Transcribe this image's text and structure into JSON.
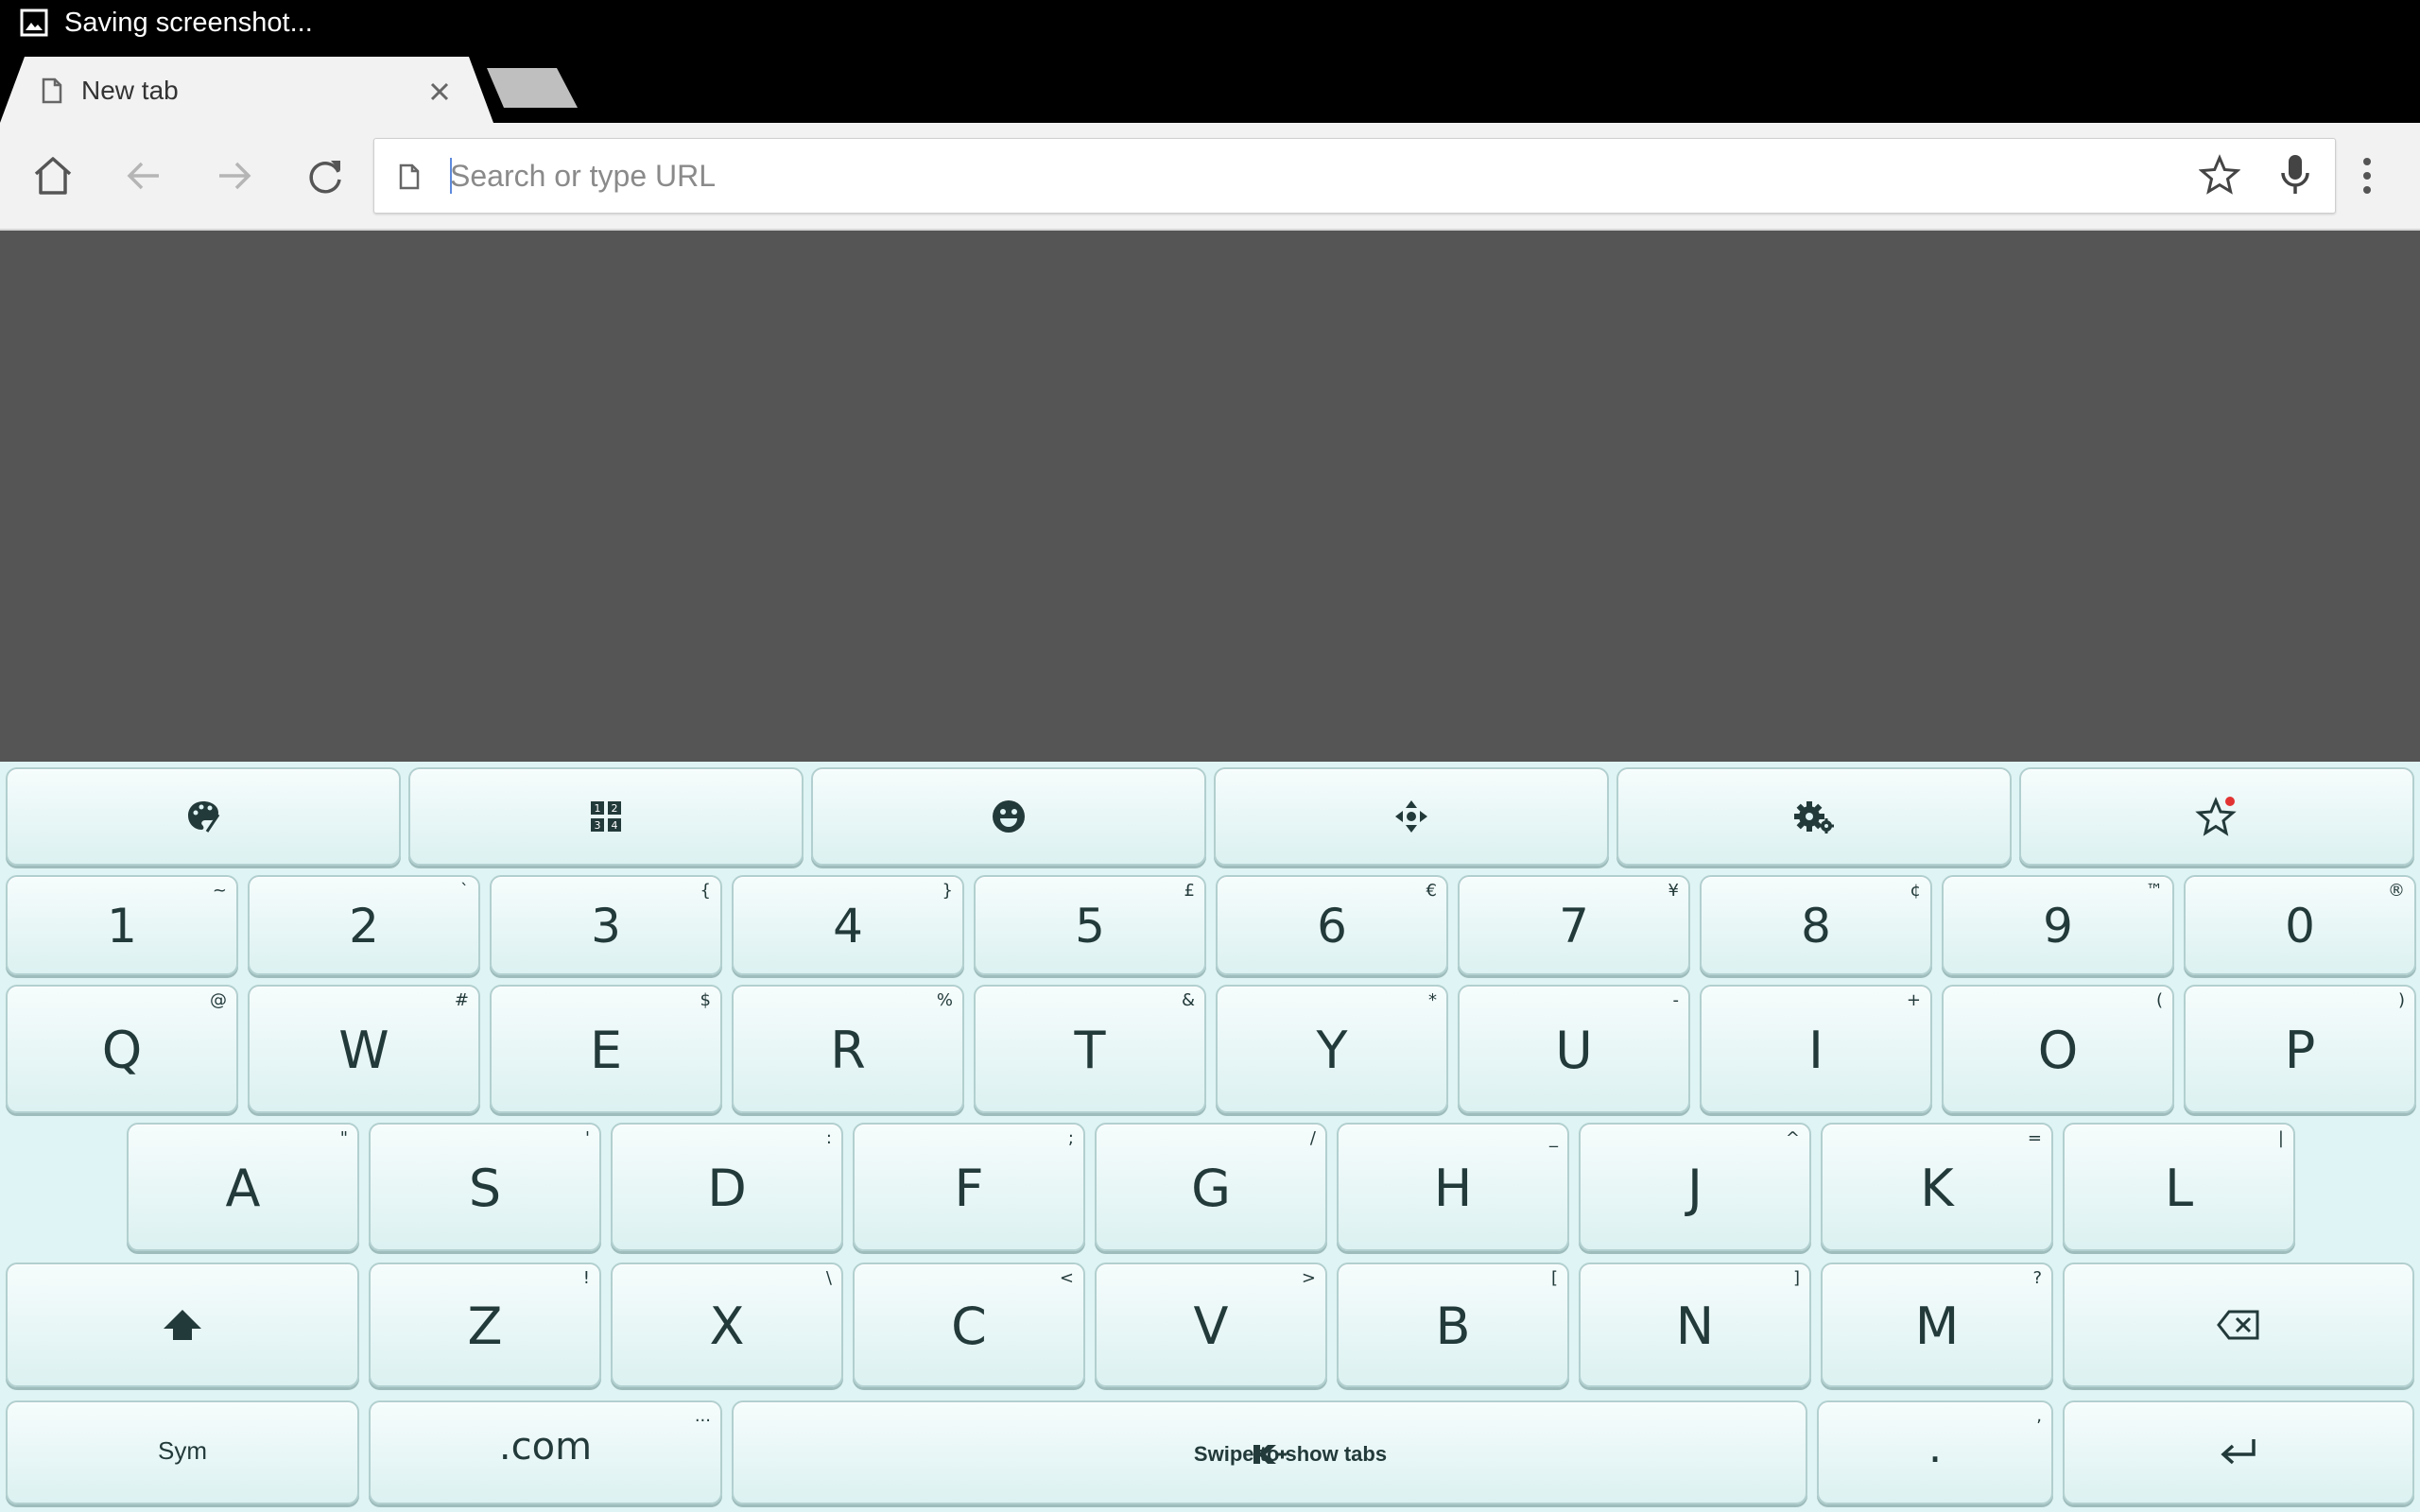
{
  "status_bar": {
    "notification_text": "Saving screenshot..."
  },
  "tab": {
    "title": "New tab"
  },
  "omnibox": {
    "placeholder": "Search or type URL"
  },
  "keyboard": {
    "number_row": [
      {
        "label": "1",
        "hint": "~"
      },
      {
        "label": "2",
        "hint": "`"
      },
      {
        "label": "3",
        "hint": "{"
      },
      {
        "label": "4",
        "hint": "}"
      },
      {
        "label": "5",
        "hint": "£"
      },
      {
        "label": "6",
        "hint": "€"
      },
      {
        "label": "7",
        "hint": "¥"
      },
      {
        "label": "8",
        "hint": "¢"
      },
      {
        "label": "9",
        "hint": "™"
      },
      {
        "label": "0",
        "hint": "®"
      }
    ],
    "row_q": [
      {
        "label": "Q",
        "hint": "@"
      },
      {
        "label": "W",
        "hint": "#"
      },
      {
        "label": "E",
        "hint": "$"
      },
      {
        "label": "R",
        "hint": "%"
      },
      {
        "label": "T",
        "hint": "&"
      },
      {
        "label": "Y",
        "hint": "*"
      },
      {
        "label": "U",
        "hint": "-"
      },
      {
        "label": "I",
        "hint": "+"
      },
      {
        "label": "O",
        "hint": "("
      },
      {
        "label": "P",
        "hint": ")"
      }
    ],
    "row_a": [
      {
        "label": "A",
        "hint": "\""
      },
      {
        "label": "S",
        "hint": "'"
      },
      {
        "label": "D",
        "hint": ":"
      },
      {
        "label": "F",
        "hint": ";"
      },
      {
        "label": "G",
        "hint": "/"
      },
      {
        "label": "H",
        "hint": "_"
      },
      {
        "label": "J",
        "hint": "^"
      },
      {
        "label": "K",
        "hint": "="
      },
      {
        "label": "L",
        "hint": "|"
      }
    ],
    "row_z": [
      {
        "label": "Z",
        "hint": "!"
      },
      {
        "label": "X",
        "hint": "\\"
      },
      {
        "label": "C",
        "hint": "<"
      },
      {
        "label": "V",
        "hint": ">"
      },
      {
        "label": "B",
        "hint": "["
      },
      {
        "label": "N",
        "hint": "]"
      },
      {
        "label": "M",
        "hint": "?"
      }
    ],
    "sym_label": "Sym",
    "dotcom_label": ".com",
    "dotcom_hint": "...",
    "space_label": "Swipe to show tabs",
    "period_label": ".",
    "period_hint": ","
  }
}
